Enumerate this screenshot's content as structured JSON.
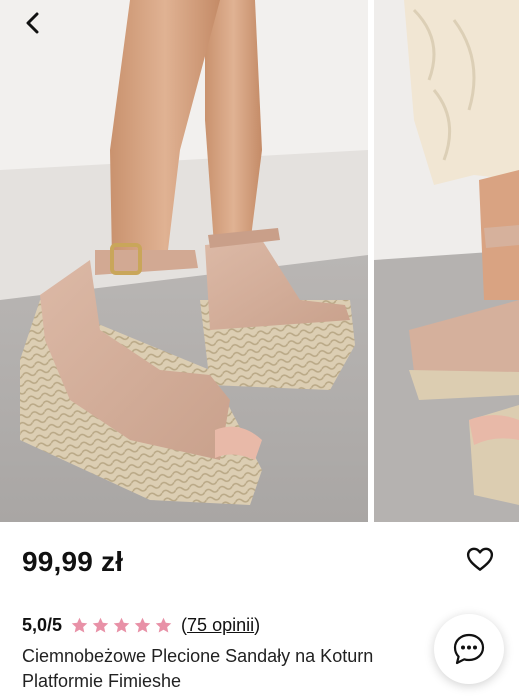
{
  "product": {
    "price": "99,99 zł",
    "rating_score": "5,0/5",
    "rating_stars": 5,
    "reviews_count_label": "75 opinii",
    "title_line1": "Ciemnobeżowe Plecione Sandały na Koturn",
    "title_line2": "Platformie Fimieshe"
  },
  "colors": {
    "star": "#e891a7",
    "text": "#111111"
  },
  "icons": {
    "back": "chevron-left-icon",
    "favorite": "heart-outline-icon",
    "chat": "chat-bubble-icon"
  }
}
